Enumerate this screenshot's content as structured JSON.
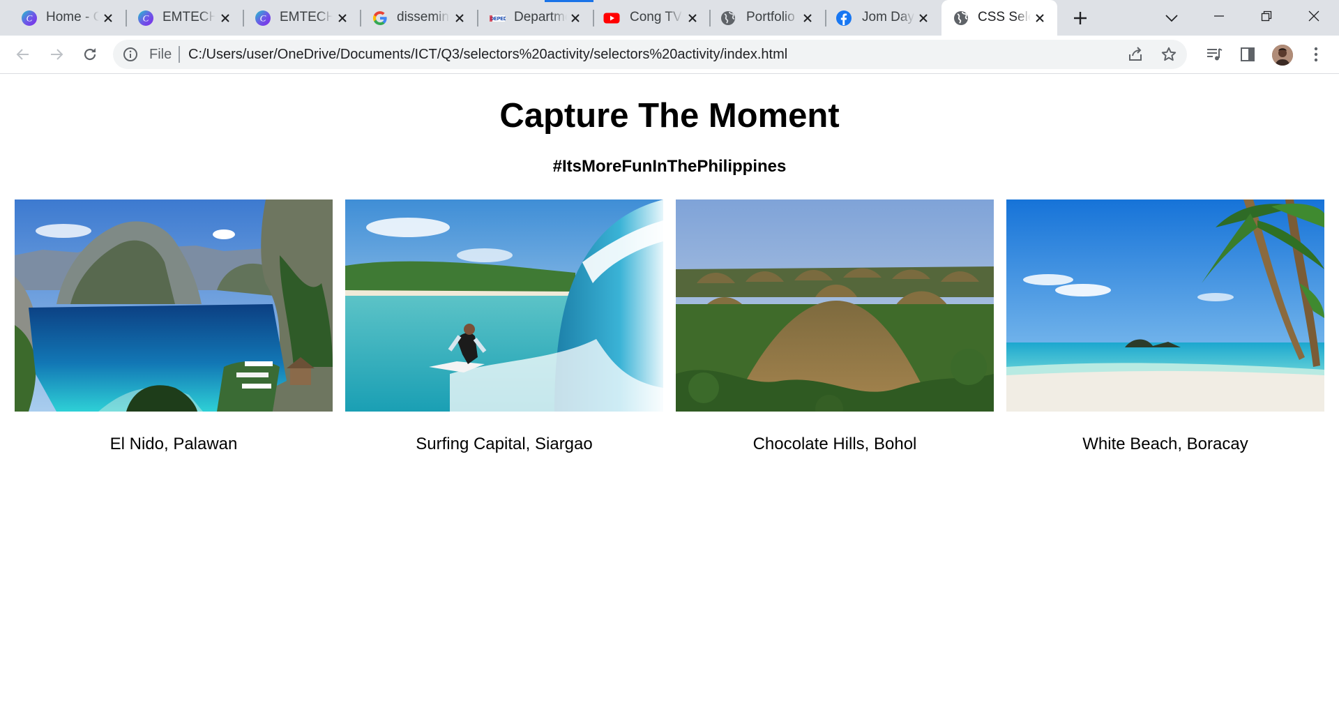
{
  "browser": {
    "tabs": [
      {
        "title": "Home - Canva",
        "icon": "canva-icon",
        "active": false
      },
      {
        "title": "EMTECH",
        "icon": "canva-icon",
        "active": false
      },
      {
        "title": "EMTECH",
        "icon": "canva-icon",
        "active": false
      },
      {
        "title": "dissemination",
        "icon": "google-icon",
        "active": false
      },
      {
        "title": "Department",
        "icon": "deped-icon",
        "active": false
      },
      {
        "title": "Cong TV",
        "icon": "youtube-icon",
        "active": false
      },
      {
        "title": "Portfolio",
        "icon": "globe-icon",
        "active": false
      },
      {
        "title": "Jom Day",
        "icon": "facebook-icon",
        "active": false
      },
      {
        "title": "CSS Selectors",
        "icon": "globe-icon",
        "active": true
      }
    ],
    "address": {
      "scheme_label": "File",
      "url": "C:/Users/user/OneDrive/Documents/ICT/Q3/selectors%20activity/selectors%20activity/index.html"
    },
    "colors": {
      "tabstrip": "#dee1e6",
      "omnibox": "#f1f3f4",
      "accent": "#1a73e8"
    }
  },
  "page": {
    "heading": "Capture The Moment",
    "subheading": "#ItsMoreFunInThePhilippines",
    "gallery": [
      {
        "caption": "El Nido, Palawan",
        "image": "el-nido-lagoon-photo"
      },
      {
        "caption": "Surfing Capital, Siargao",
        "image": "siargao-surfer-photo"
      },
      {
        "caption": "Chocolate Hills, Bohol",
        "image": "chocolate-hills-photo"
      },
      {
        "caption": "White Beach, Boracay",
        "image": "boracay-beach-photo"
      }
    ]
  }
}
